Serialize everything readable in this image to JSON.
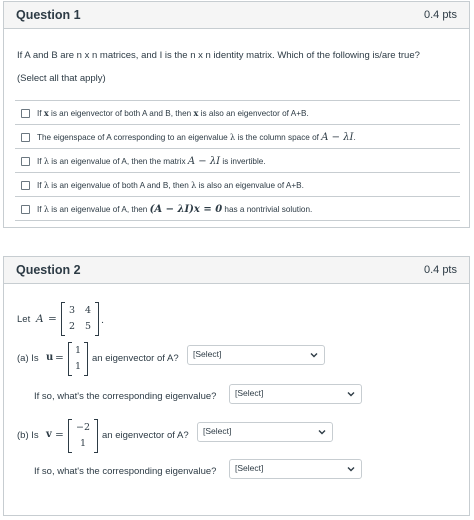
{
  "q1": {
    "title": "Question 1",
    "points": "0.4 pts",
    "prompt": "If A and B are n x n matrices, and I is the n x n identity matrix. Which of the following is/are true?",
    "instruction": "(Select all that apply)",
    "answers": [
      {
        "a": "If ",
        "b": "x",
        "c": " is an eigenvector of both A and B, then ",
        "d": "x",
        "e": " is also an eigenvector of A+B."
      },
      {
        "a": "The eigenspace of A corresponding to an eigenvalue ",
        "b": "λ",
        "c": " is the column space of ",
        "d": "A − λI",
        "e": "."
      },
      {
        "a": "If ",
        "b": "λ",
        "c": " is an eigenvalue of A, then the matrix ",
        "d": "A − λI",
        "e": " is invertible."
      },
      {
        "a": "If ",
        "b": "λ",
        "c": " is an eigenvalue of both A and B, then ",
        "d": "λ",
        "e": " is also an eigenvalue of A+B."
      },
      {
        "a": "If ",
        "b": "λ",
        "c": " is an eigenvalue of A, then ",
        "d": "(A − λI)x = 0",
        "e": " has a nontrivial solution."
      }
    ]
  },
  "q2": {
    "title": "Question 2",
    "points": "0.4 pts",
    "let_prefix": "Let",
    "matrix_name": "A",
    "eq": "=",
    "matrix_A": [
      "3",
      "4",
      "2",
      "5"
    ],
    "period": ".",
    "part_a": {
      "label": "(a) Is",
      "var": "u",
      "vector": [
        "1",
        "1"
      ],
      "suffix": "an eigenvector of A?",
      "select": "Select",
      "followup": "If so, what's the corresponding eigenvalue?",
      "followup_select": "Select"
    },
    "part_b": {
      "label": "(b) Is",
      "var": "v",
      "vector": [
        "−2",
        "1"
      ],
      "suffix": "an eigenvector of A?",
      "select": "Select",
      "followup": "If so, what's the corresponding eigenvalue?",
      "followup_select": "Select"
    }
  }
}
